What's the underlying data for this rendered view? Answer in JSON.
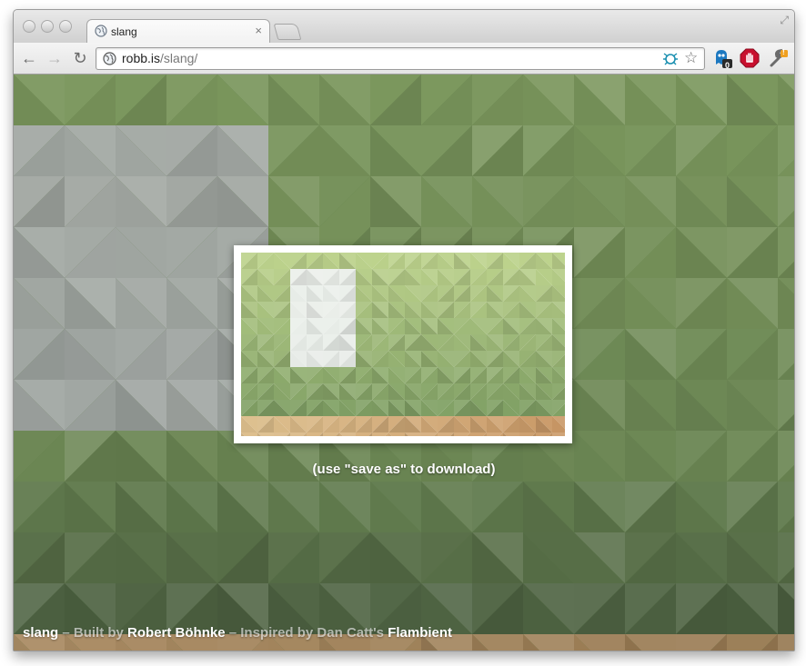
{
  "tab": {
    "title": "slang",
    "close_glyph": "×"
  },
  "toolbar": {
    "back_glyph": "←",
    "forward_glyph": "→",
    "reload_glyph": "↻",
    "url_host": "robb.is",
    "url_path": "/slang/",
    "star_glyph": "☆"
  },
  "extensions": {
    "ghostery_count": "0",
    "wrench_badge": "!"
  },
  "page": {
    "hint": "(use \"save as\" to download)",
    "footer": {
      "app_name": "slang",
      "sep1": " – ",
      "built_by": "Built by ",
      "author": "Robert Böhnke",
      "sep2": " – ",
      "inspired_by": "Inspired by Dan Catt's ",
      "flambient": "Flambient"
    }
  },
  "colors": {
    "accent_green": "#6e8a4e",
    "ghostery_blue": "#1c78c0",
    "adblock_red": "#c8102e",
    "wrench_orange": "#f0a020"
  },
  "icons": [
    "globe-icon",
    "close-icon",
    "back-arrow-icon",
    "forward-arrow-icon",
    "reload-icon",
    "star-icon",
    "ghostery-icon",
    "adblock-icon",
    "wrench-icon",
    "fullscreen-icon"
  ]
}
